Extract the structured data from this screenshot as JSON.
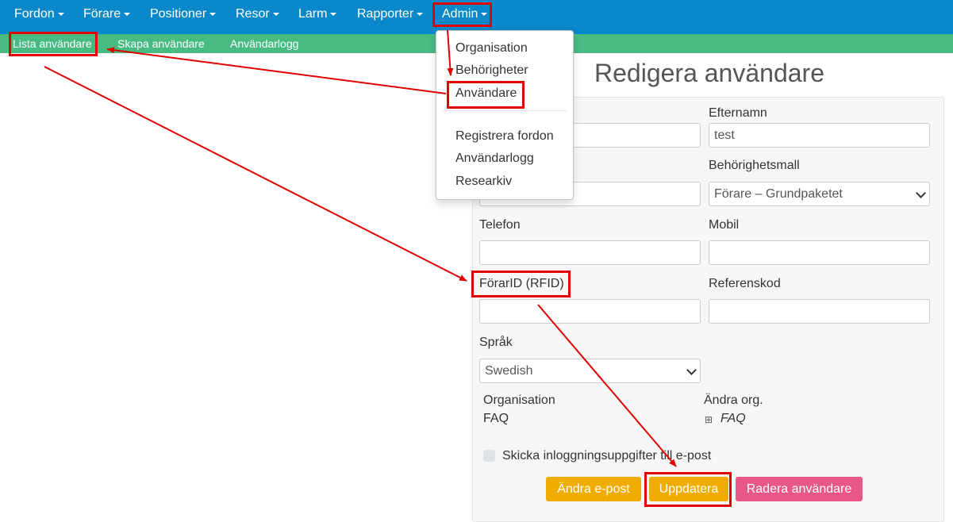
{
  "topnav": {
    "items": [
      {
        "label": "Fordon"
      },
      {
        "label": "Förare"
      },
      {
        "label": "Positioner"
      },
      {
        "label": "Resor"
      },
      {
        "label": "Larm"
      },
      {
        "label": "Rapporter"
      },
      {
        "label": "Admin"
      }
    ]
  },
  "subnav": {
    "items": [
      {
        "label": "Lista användare"
      },
      {
        "label": "Skapa användare"
      },
      {
        "label": "Användarlogg"
      }
    ]
  },
  "admin_menu": {
    "items": [
      {
        "label": "Organisation"
      },
      {
        "label": "Behörigheter"
      },
      {
        "label": "Användare"
      },
      {
        "label": "Registrera fordon"
      },
      {
        "label": "Användarlogg"
      },
      {
        "label": "Researkiv"
      }
    ]
  },
  "page": {
    "title": "Redigera användare"
  },
  "form": {
    "efternamn_label": "Efternamn",
    "efternamn_value": "test",
    "behorighetsmall_label": "Behörighetsmall",
    "behorighetsmall_value": "Förare – Grundpaketet",
    "telefon_label": "Telefon",
    "mobil_label": "Mobil",
    "forarid_label": "FörarID (RFID)",
    "referenskod_label": "Referenskod",
    "sprak_label": "Språk",
    "sprak_value": "Swedish",
    "organisation_label": "Organisation",
    "organisation_value": "FAQ",
    "andra_org_label": "Ändra org.",
    "andra_org_value": "FAQ",
    "tree_toggle": "⊞",
    "send_login_label": "Skicka inloggningsuppgifter till e-post",
    "buttons": {
      "andra_epost": "Ändra e-post",
      "uppdatera": "Uppdatera",
      "radera": "Radera användare"
    }
  },
  "colors": {
    "topnav_bg": "#0b88c9",
    "subnav_bg": "#48bb83",
    "btn_orange": "#f0ad00",
    "btn_pink": "#e8578a",
    "annotation_red": "#e00000"
  }
}
